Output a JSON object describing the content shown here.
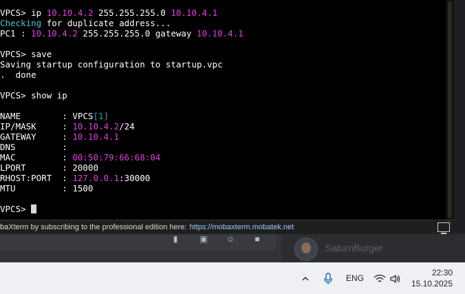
{
  "terminal": {
    "lines": [
      [
        {
          "t": "VPCS> ip ",
          "c": "white"
        },
        {
          "t": "10.10.4.2",
          "c": "magenta"
        },
        {
          "t": " 255.255.255.0 ",
          "c": "white"
        },
        {
          "t": "10.10.4.1",
          "c": "magenta"
        }
      ],
      [
        {
          "t": "Checking",
          "c": "cyan"
        },
        {
          "t": " for duplicate address...",
          "c": "white"
        }
      ],
      [
        {
          "t": "PC1 : ",
          "c": "white"
        },
        {
          "t": "10.10.4.2",
          "c": "magenta"
        },
        {
          "t": " 255.255.255.0 gateway ",
          "c": "white"
        },
        {
          "t": "10.10.4.1",
          "c": "magenta"
        }
      ],
      [],
      [
        {
          "t": "VPCS> save",
          "c": "white"
        }
      ],
      [
        {
          "t": "Saving startup configuration to startup.vpc",
          "c": "white"
        }
      ],
      [
        {
          "t": ".  done",
          "c": "white"
        }
      ],
      [],
      [
        {
          "t": "VPCS> show ip",
          "c": "white"
        }
      ],
      [],
      [
        {
          "t": "NAME        : VPCS",
          "c": "white"
        },
        {
          "t": "[1]",
          "c": "teal"
        }
      ],
      [
        {
          "t": "IP/MASK     : ",
          "c": "white"
        },
        {
          "t": "10.10.4.2",
          "c": "magenta"
        },
        {
          "t": "/24",
          "c": "white"
        }
      ],
      [
        {
          "t": "GATEWAY     : ",
          "c": "white"
        },
        {
          "t": "10.10.4.1",
          "c": "magenta"
        }
      ],
      [
        {
          "t": "DNS         : ",
          "c": "white"
        }
      ],
      [
        {
          "t": "MAC         : ",
          "c": "white"
        },
        {
          "t": "00:50:79:66:68:04",
          "c": "magenta"
        }
      ],
      [
        {
          "t": "LPORT       : 20000",
          "c": "white"
        }
      ],
      [
        {
          "t": "RHOST:PORT  : ",
          "c": "white"
        },
        {
          "t": "127.0.0.1",
          "c": "magenta"
        },
        {
          "t": ":30000",
          "c": "white"
        }
      ],
      [
        {
          "t": "MTU         : 1500",
          "c": "white"
        }
      ],
      [],
      [
        {
          "t": "VPCS> ",
          "c": "white"
        }
      ]
    ]
  },
  "statusbar": {
    "message": "baXterm by subscribing to the professional edition here:",
    "link": "https://mobaxterm.mobatek.net"
  },
  "background_app": {
    "member_name": "SaturnBurger"
  },
  "taskbar": {
    "language": "ENG",
    "time": "22:30",
    "date": "15.10.2025"
  },
  "colors": {
    "magenta": "#e040e0",
    "cyan": "#3ec6e0",
    "teal": "#2aa8a8",
    "white": "#ffffff"
  },
  "icons": [
    "chevron-up-icon",
    "microphone-icon",
    "wifi-icon",
    "speaker-icon",
    "screen-icon",
    "gif-icon",
    "sticker-icon",
    "emoji-icon",
    "gamepad-icon"
  ]
}
